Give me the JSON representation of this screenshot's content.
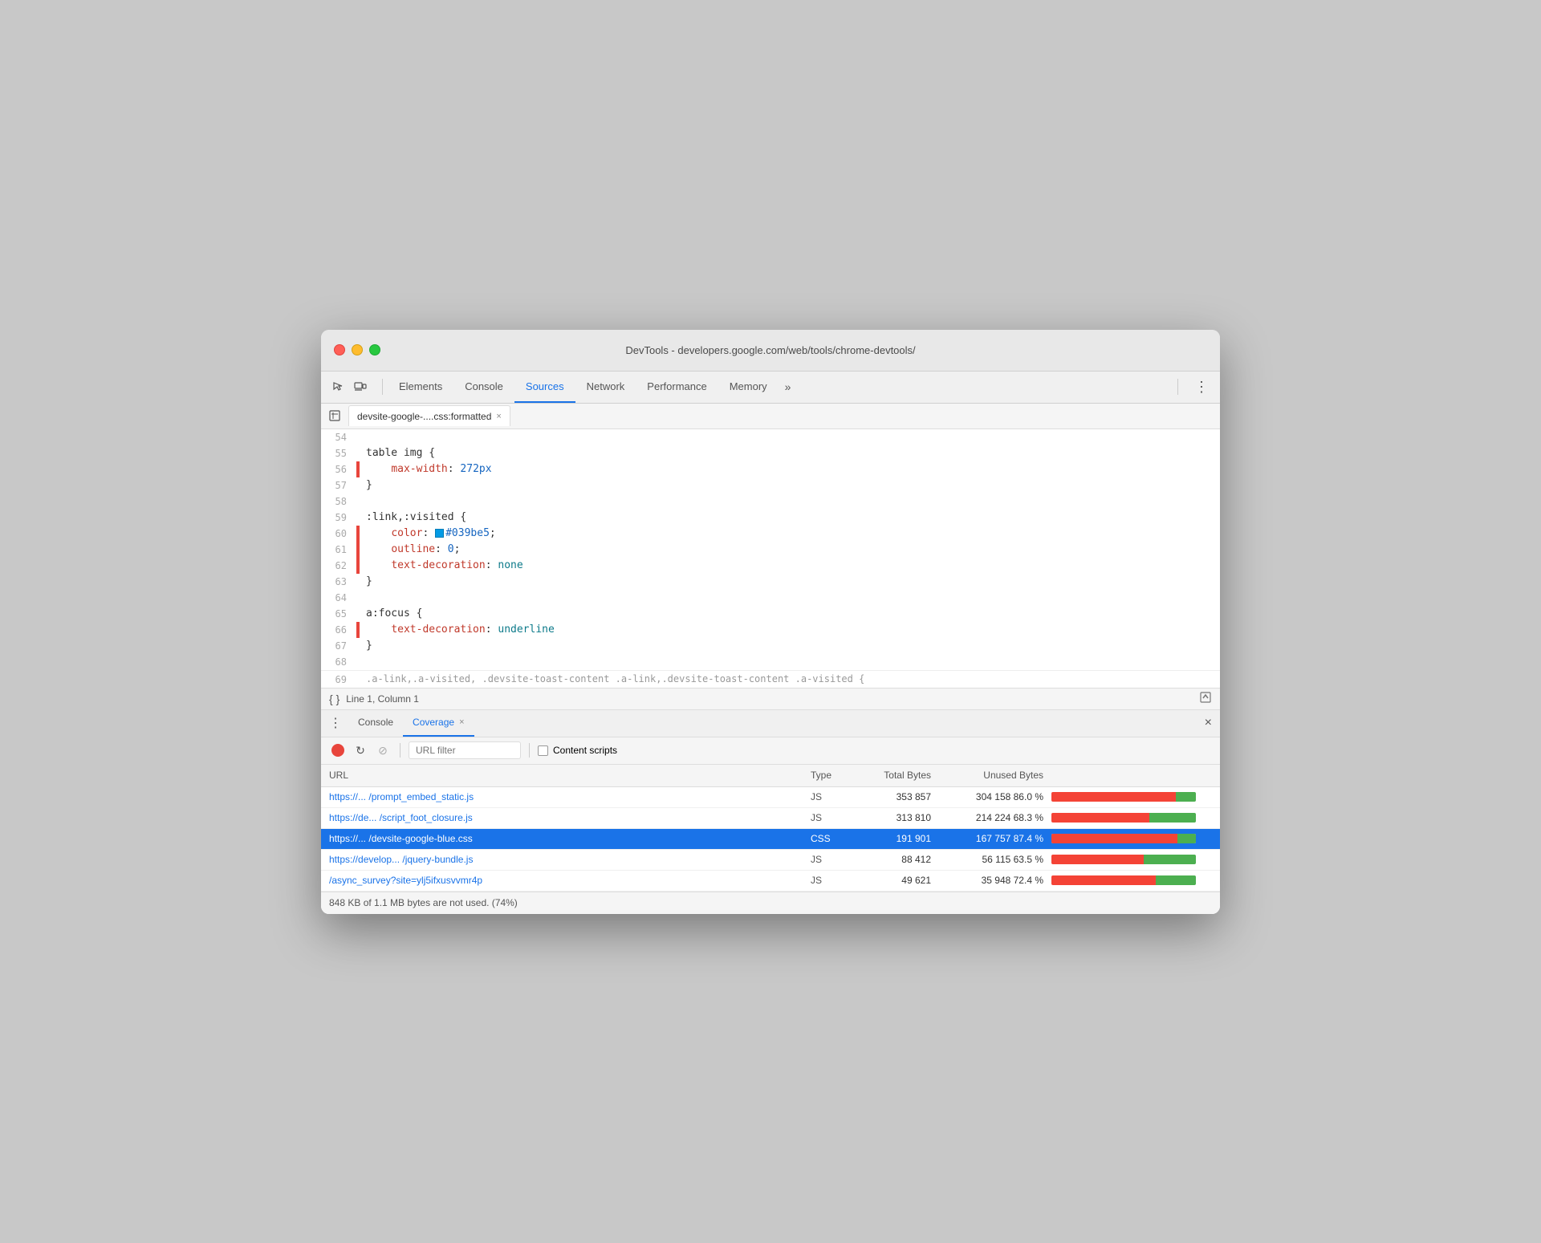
{
  "window": {
    "title": "DevTools - developers.google.com/web/tools/chrome-devtools/"
  },
  "tabs": [
    {
      "id": "elements",
      "label": "Elements",
      "active": false
    },
    {
      "id": "console",
      "label": "Console",
      "active": false
    },
    {
      "id": "sources",
      "label": "Sources",
      "active": true
    },
    {
      "id": "network",
      "label": "Network",
      "active": false
    },
    {
      "id": "performance",
      "label": "Performance",
      "active": false
    },
    {
      "id": "memory",
      "label": "Memory",
      "active": false
    }
  ],
  "filetab": {
    "name": "devsite-google-....css:formatted",
    "close": "×"
  },
  "statusbar": {
    "label": "Line 1, Column 1"
  },
  "bottomtabs": {
    "console_label": "Console",
    "coverage_label": "Coverage",
    "coverage_close": "×",
    "close_panel": "×"
  },
  "coverage": {
    "filter_placeholder": "URL filter",
    "content_scripts_label": "Content scripts",
    "columns": {
      "url": "URL",
      "type": "Type",
      "total": "Total Bytes",
      "unused": "Unused Bytes"
    },
    "rows": [
      {
        "url": "https://... /prompt_embed_static.js",
        "type": "JS",
        "total": "353 857",
        "unused": "304 158 86.0 %",
        "used_pct": 14,
        "unused_pct": 86,
        "selected": false
      },
      {
        "url": "https://de... /script_foot_closure.js",
        "type": "JS",
        "total": "313 810",
        "unused": "214 224 68.3 %",
        "used_pct": 32,
        "unused_pct": 68,
        "selected": false
      },
      {
        "url": "https://... /devsite-google-blue.css",
        "type": "CSS",
        "total": "191 901",
        "unused": "167 757 87.4 %",
        "used_pct": 13,
        "unused_pct": 87,
        "selected": true
      },
      {
        "url": "https://develop... /jquery-bundle.js",
        "type": "JS",
        "total": "88 412",
        "unused": "56 115 63.5 %",
        "used_pct": 36,
        "unused_pct": 64,
        "selected": false
      },
      {
        "url": "/async_survey?site=ylj5ifxusvvmr4p",
        "type": "JS",
        "total": "49 621",
        "unused": "35 948 72.4 %",
        "used_pct": 28,
        "unused_pct": 72,
        "selected": false
      }
    ],
    "footer": "848 KB of 1.1 MB bytes are not used. (74%)"
  },
  "code": {
    "lines": [
      {
        "num": "54",
        "content": "",
        "gutter": false
      },
      {
        "num": "55",
        "content": "table img {",
        "gutter": false
      },
      {
        "num": "56",
        "content": "    max-width: 272px",
        "gutter": true,
        "type": "prop-val",
        "prop": "max-width",
        "val": "272px"
      },
      {
        "num": "57",
        "content": "}",
        "gutter": false
      },
      {
        "num": "58",
        "content": "",
        "gutter": false
      },
      {
        "num": "59",
        "content": ":link,:visited {",
        "gutter": false
      },
      {
        "num": "60",
        "content": "    color: #039be5;",
        "gutter": true,
        "type": "color-prop",
        "prop": "color",
        "color": "#039be5"
      },
      {
        "num": "61",
        "content": "    outline: 0;",
        "gutter": true
      },
      {
        "num": "62",
        "content": "    text-decoration: none",
        "gutter": true,
        "type": "prop-val",
        "prop": "text-decoration",
        "val": "none"
      },
      {
        "num": "63",
        "content": "}",
        "gutter": false
      },
      {
        "num": "64",
        "content": "",
        "gutter": false
      },
      {
        "num": "65",
        "content": "a:focus {",
        "gutter": false
      },
      {
        "num": "66",
        "content": "    text-decoration: underline",
        "gutter": true,
        "type": "prop-val",
        "prop": "text-decoration",
        "val": "underline"
      },
      {
        "num": "67",
        "content": "}",
        "gutter": false
      },
      {
        "num": "68",
        "content": "",
        "gutter": false
      }
    ]
  },
  "colors": {
    "accent_blue": "#1a73e8",
    "tab_active_border": "#1a73e8",
    "record_red": "#e8453c",
    "selected_row_bg": "#1a73e8",
    "bar_used": "#4caf50",
    "bar_unused": "#f44336"
  }
}
